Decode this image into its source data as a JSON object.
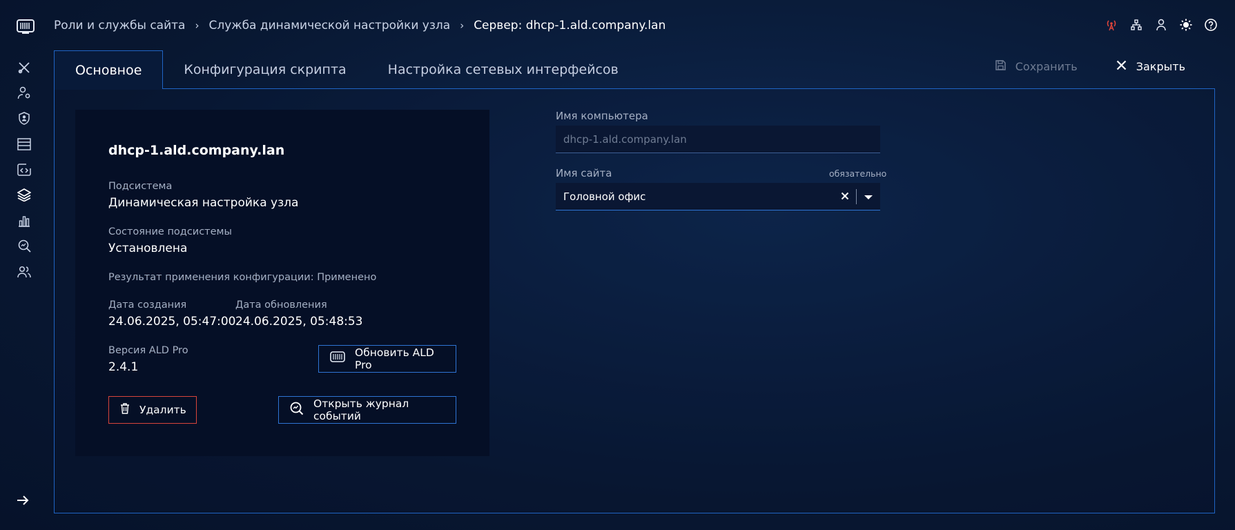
{
  "breadcrumb": {
    "items": [
      "Роли и службы сайта",
      "Служба динамической настройки узла"
    ],
    "current": "Сервер: dhcp-1.ald.company.lan"
  },
  "header_icons": [
    "antenna-icon",
    "hierarchy-icon",
    "user-icon",
    "sun-icon",
    "help-icon"
  ],
  "nav_icons": [
    "tools-icon",
    "user-settings-icon",
    "user-badge-icon",
    "server-icon",
    "code-icon",
    "layers-icon",
    "bar-chart-icon",
    "search-analytics-icon",
    "users-icon"
  ],
  "tabs": [
    {
      "label": "Основное",
      "active": true
    },
    {
      "label": "Конфигурация скрипта",
      "active": false
    },
    {
      "label": "Настройка сетевых интерфейсов",
      "active": false
    }
  ],
  "actions": {
    "save": "Сохранить",
    "close": "Закрыть"
  },
  "card": {
    "title": "dhcp-1.ald.company.lan",
    "subsystem_label": "Подсистема",
    "subsystem_value": "Динамическая настройка узла",
    "state_label": "Состояние подсистемы",
    "state_value": "Установлена",
    "config_result": "Результат применения конфигурации: Применено",
    "created_label": "Дата создания",
    "created_value": "24.06.2025, 05:47:00",
    "updated_label": "Дата обновления",
    "updated_value": "24.06.2025, 05:48:53",
    "version_label": "Версия ALD Pro",
    "version_value": "2.4.1",
    "update_button": "Обновить ALD Pro",
    "delete_button": "Удалить",
    "log_button": "Открыть журнал событий"
  },
  "form": {
    "computer_name_label": "Имя компьютера",
    "computer_name_placeholder": "dhcp-1.ald.company.lan",
    "site_name_label": "Имя сайта",
    "site_name_required": "обязательно",
    "site_name_value": "Головной офис"
  },
  "colors": {
    "accent": "#2e74d4",
    "danger": "#d8453b",
    "antenna": "#e0453b"
  }
}
